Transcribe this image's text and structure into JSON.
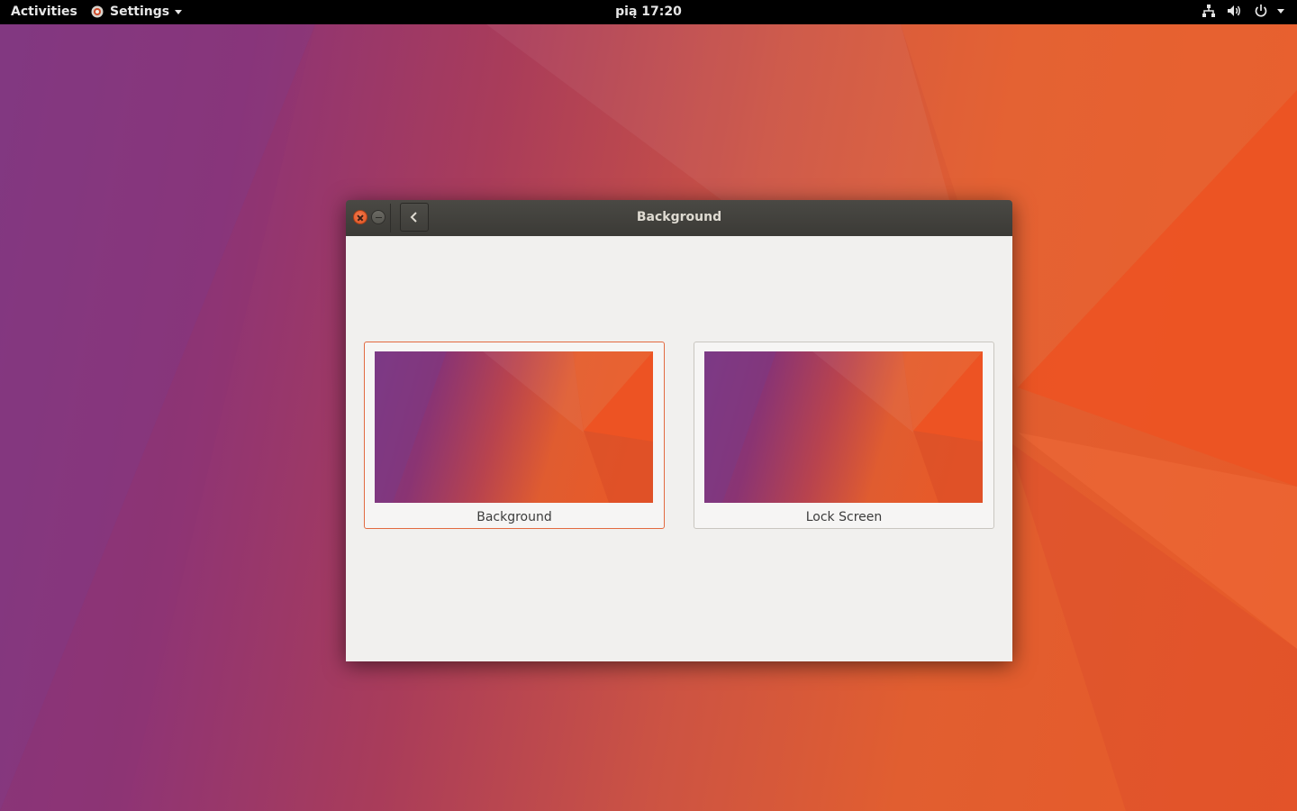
{
  "topbar": {
    "activities": "Activities",
    "app_menu": {
      "label": "Settings",
      "icon": "settings-gear-icon"
    },
    "clock": "pią 17:20",
    "tray": [
      "network-icon",
      "volume-icon",
      "power-icon"
    ]
  },
  "window": {
    "title": "Background",
    "buttons": [
      "close-icon",
      "minimize-icon",
      "back-icon"
    ],
    "cards": [
      {
        "label": "Background",
        "selected": true
      },
      {
        "label": "Lock Screen",
        "selected": false
      }
    ]
  },
  "colors": {
    "accent": "#e26a40",
    "wallpaper_purple": "#84387f",
    "wallpaper_orange": "#e85a28",
    "titlebar": "#3e3d39",
    "content_bg": "#f1f0ee"
  }
}
